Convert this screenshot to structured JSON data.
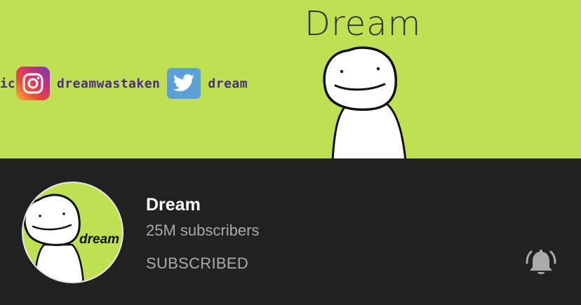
{
  "banner": {
    "title": "Dream",
    "social_prefix": "ic",
    "instagram_handle": "dreamwastaken",
    "twitter_handle": "dream",
    "background_color": "#bfe052"
  },
  "channel": {
    "avatar_text": "dream",
    "name": "Dream",
    "subscribers": "25M subscribers",
    "subscribe_state": "SUBSCRIBED",
    "notification_icon": "bell-ringing-icon"
  }
}
